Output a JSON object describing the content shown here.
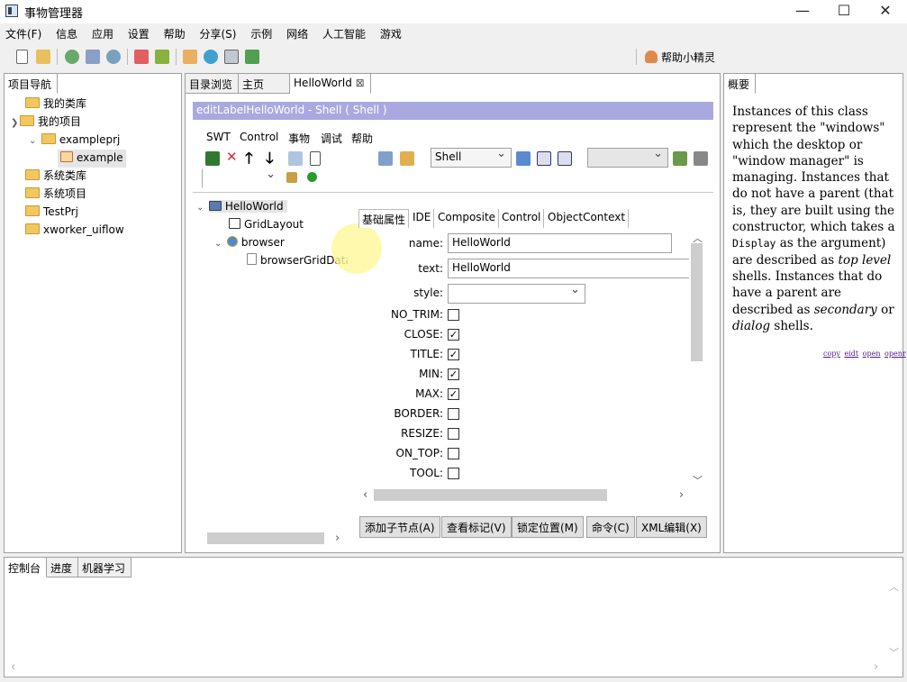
{
  "window": {
    "title": "事物管理器",
    "minimize_icon": "—",
    "maximize_icon": "☐",
    "close_icon": "✕"
  },
  "menu": [
    "文件(F)",
    "信息",
    "应用",
    "设置",
    "帮助",
    "分享(S)",
    "示例",
    "网络",
    "人工智能",
    "游戏"
  ],
  "toolbar": {
    "helper_label": "帮助小精灵"
  },
  "nav": {
    "tab": "项目导航",
    "items": [
      {
        "label": "我的类库"
      },
      {
        "label": "我的项目"
      },
      {
        "label": "exampleprj"
      },
      {
        "label": "example"
      },
      {
        "label": "系统类库"
      },
      {
        "label": "系统项目"
      },
      {
        "label": "TestPrj"
      },
      {
        "label": "xworker_uiflow"
      }
    ]
  },
  "editor": {
    "tabs": [
      "目录浏览",
      "主页",
      "HelloWorld"
    ],
    "shell_title": "editLabelHelloWorld - Shell ( Shell )",
    "inner_menu": [
      "SWT",
      "Control",
      "事物",
      "调试",
      "帮助"
    ],
    "type_combo": "Shell",
    "tree": [
      {
        "label": "HelloWorld"
      },
      {
        "label": "GridLayout"
      },
      {
        "label": "browser"
      },
      {
        "label": "browserGridData"
      }
    ],
    "prop_tabs": [
      "基础属性",
      "IDE",
      "Composite",
      "Control",
      "ObjectContext"
    ],
    "props": {
      "name_label": "name:",
      "name_value": "HelloWorld",
      "text_label": "text:",
      "text_value": "HelloWorld",
      "style_label": "style:",
      "style_value": ""
    },
    "flags": [
      {
        "label": "NO_TRIM:",
        "checked": false
      },
      {
        "label": "CLOSE:",
        "checked": true
      },
      {
        "label": "TITLE:",
        "checked": true
      },
      {
        "label": "MIN:",
        "checked": true
      },
      {
        "label": "MAX:",
        "checked": true
      },
      {
        "label": "BORDER:",
        "checked": false
      },
      {
        "label": "RESIZE:",
        "checked": false
      },
      {
        "label": "ON_TOP:",
        "checked": false
      },
      {
        "label": "TOOL:",
        "checked": false
      }
    ],
    "buttons": [
      "添加子节点(A)",
      "查看标记(V)",
      "锁定位置(M)",
      "命令(C)",
      "XML编辑(X)"
    ]
  },
  "summary": {
    "tab": "概要",
    "text_1": "Instances of this class represent the \"windows\" which the desktop or \"window manager\" is managing. Instances that do not have a parent (that is, they are built using the constructor, which takes a",
    "code": "Display",
    "text_2": "as the argument) are described as",
    "em_1": "top level",
    "text_3": "shells. Instances that do have a parent are described as",
    "em_2": "secondary",
    "text_4": "or",
    "em_3": "dialog",
    "text_5": "shells.",
    "links": [
      "copy",
      "eidt",
      "open",
      "openr"
    ]
  },
  "console": {
    "tabs": [
      "控制台",
      "进度",
      "机器学习"
    ]
  },
  "colors": {
    "shell_title_bg": "#a9a9e0",
    "selection_bg": "#e5e5e5",
    "highlight_circle": "#fff89a"
  }
}
